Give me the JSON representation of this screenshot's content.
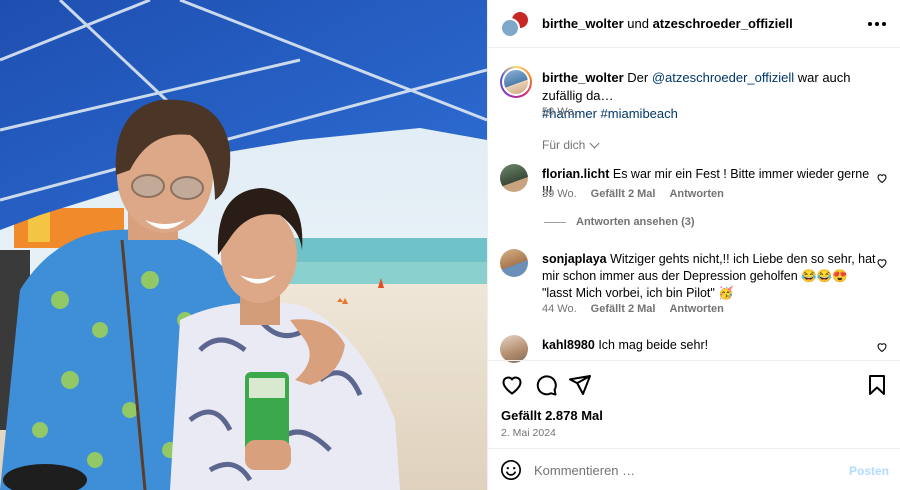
{
  "header": {
    "user1": "birthe_wolter",
    "conjunction": "und",
    "user2": "atzeschroeder_offiziell"
  },
  "caption": {
    "username": "birthe_wolter",
    "text_before": "Der",
    "mention": "@atzeschroeder_offiziell",
    "text_after": "war auch zufällig da…",
    "tags": [
      "#hammer",
      "#miamibeach"
    ],
    "time": "50 Wo."
  },
  "filter_label": "Für dich",
  "comments": [
    {
      "username": "florian.licht",
      "text": "Es war mir ein Fest ! Bitte immer wieder gerne !!!",
      "time": "39 Wo.",
      "likes": "Gefällt 2 Mal",
      "reply": "Antworten"
    },
    {
      "username": "sonjaplaya",
      "text": "Witziger gehts nicht,!! ich Liebe den so sehr, hat mir schon immer aus der Depression geholfen 😂😂😍 \"lasst Mich vorbei, ich bin Pilot\" 🥳",
      "time": "44 Wo.",
      "likes": "Gefällt 2 Mal",
      "reply": "Antworten"
    },
    {
      "username": "kahl8980",
      "text": "Ich mag beide sehr!"
    }
  ],
  "view_replies": "Antworten ansehen (3)",
  "likes_text": "Gefällt 2.878 Mal",
  "post_date": "2. Mai 2024",
  "composer": {
    "placeholder": "Kommentieren …",
    "post_label": "Posten"
  },
  "icons": {
    "like": "heart-icon",
    "comment": "comment-icon",
    "share": "share-icon",
    "save": "bookmark-icon",
    "more": "more-icon",
    "emoji": "emoji-icon"
  },
  "colors": {
    "link": "#00376b",
    "muted": "#737373",
    "post_disabled": "#b3dbff"
  }
}
